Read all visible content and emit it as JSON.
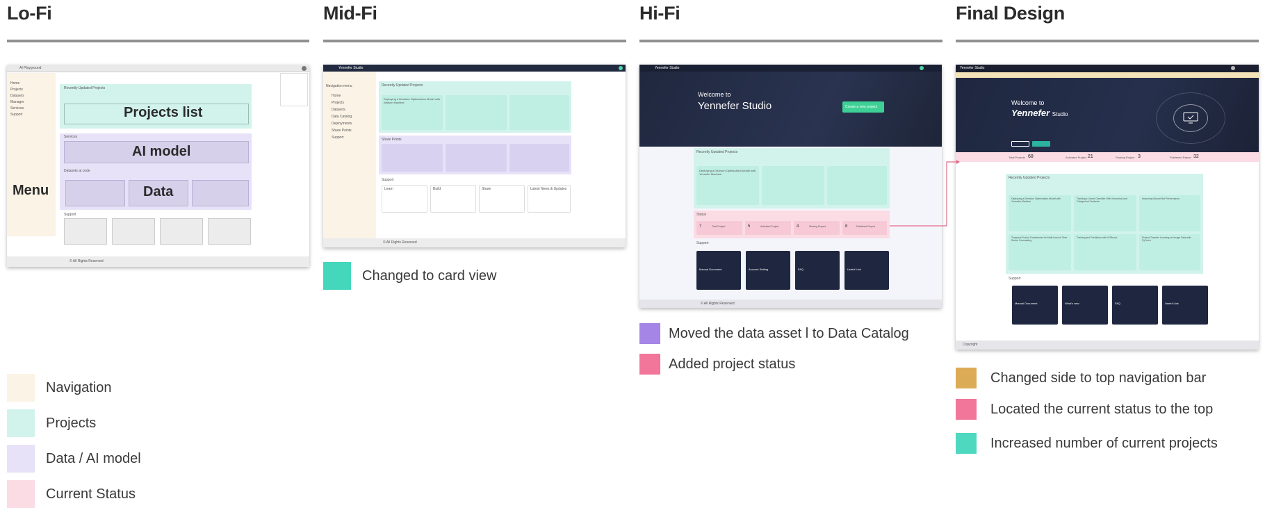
{
  "stages": {
    "lofi": {
      "title": "Lo-Fi"
    },
    "midfi": {
      "title": "Mid-Fi"
    },
    "hifi": {
      "title": "Hi-Fi"
    },
    "final": {
      "title": "Final Design"
    }
  },
  "lofi_shot": {
    "app_title": "AI Playground",
    "nav_items": [
      "Home",
      "Projects",
      "Datasets",
      "Manager",
      "Services",
      "Support"
    ],
    "menu_label": "Menu",
    "projects_heading": "Recently Updated Projects",
    "projects_label": "Projects list",
    "services_heading": "Services",
    "ai_label": "AI model",
    "datasets_heading": "Datasets at code",
    "data_label": "Data",
    "support_heading": "Support",
    "footer": "© All Rights Reserved"
  },
  "midfi_shot": {
    "app_title": "Yennefer Studio",
    "nav_heading": "Navigation menu",
    "nav_items": [
      "Home",
      "Projects",
      "Datasets",
      "Data Catalog",
      "Deployments",
      "Share Points",
      "Support"
    ],
    "projects_heading": "Recently Updated Projects",
    "card_title": "Deploying a Decision Optimization Model with Watson Machine",
    "shared_heading": "Share Points",
    "support_heading": "Support",
    "support_cards": [
      "Learn",
      "Build",
      "Share",
      "Latest News & Updates"
    ],
    "footer": "© All Rights Reserved"
  },
  "hifi_shot": {
    "app_title": "Yennefer Studio",
    "welcome": "Welcome to",
    "studio": "Yennefer Studio",
    "cta": "Create a new project",
    "projects_heading": "Recently Updated Projects",
    "card_title": "Deploying a Decision Optimization Model with Yennefer Machine",
    "status_heading": "Status",
    "status_items": [
      {
        "value": "7",
        "label": "Total Project"
      },
      {
        "value": "5",
        "label": "Activated Project"
      },
      {
        "value": "4",
        "label": "Sharing Project"
      },
      {
        "value": "8",
        "label": "Published Report"
      }
    ],
    "support_heading": "Support",
    "support_cards": [
      "Manual Document",
      "Account Setting",
      "FAQ",
      "Useful Link"
    ],
    "footer": "© All Rights Reserved"
  },
  "final_shot": {
    "brand": "Yennefer Studio",
    "welcome": "Welcome to",
    "studio_word1": "Yennefer",
    "studio_word2": "Studio",
    "status_items": [
      {
        "label": "Total Projects",
        "value": "68"
      },
      {
        "label": "Activated Project",
        "value": "21"
      },
      {
        "label": "Sharing Project",
        "value": "3"
      },
      {
        "label": "Published Report",
        "value": "32"
      }
    ],
    "projects_heading": "Recently Updated Projects",
    "card_titles": [
      "Deploying a Decision Optimization Model with Yennefer Machine",
      "Training a Linear Classifier With Numerical and Categorical Features",
      "Improving Neural Net Performance",
      "Temporal Fusion Transformer for Multi-horizon Time Series Forecasting",
      "Training and Prediction with XGBoost",
      "Robust Transfer Learning on Image Data with PyTorch"
    ],
    "support_heading": "Support",
    "support_cards": [
      "Manual Document",
      "What's new",
      "FAQ",
      "Useful Link"
    ],
    "footer": "Copyright"
  },
  "legend": [
    {
      "label": "Navigation",
      "color": "#fbf3e6"
    },
    {
      "label": "Projects",
      "color": "#d2f3ec"
    },
    {
      "label": "Data / AI model",
      "color": "#e7e2f8"
    },
    {
      "label": "Current Status",
      "color": "#fbdce4"
    }
  ],
  "notes": {
    "midfi": [
      {
        "label": "Changed to card view",
        "color": "#44d7bb"
      }
    ],
    "hifi": [
      {
        "label": "Moved the data asset l to Data Catalog",
        "color": "#a585e6"
      },
      {
        "label": "Added project status",
        "color": "#f2769a"
      }
    ],
    "final": [
      {
        "label": "Changed side to top navigation bar",
        "color": "#dcab56"
      },
      {
        "label": "Located the current status to the top",
        "color": "#f2769a"
      },
      {
        "label": "Increased number of current projects",
        "color": "#4fd8c0"
      }
    ]
  }
}
